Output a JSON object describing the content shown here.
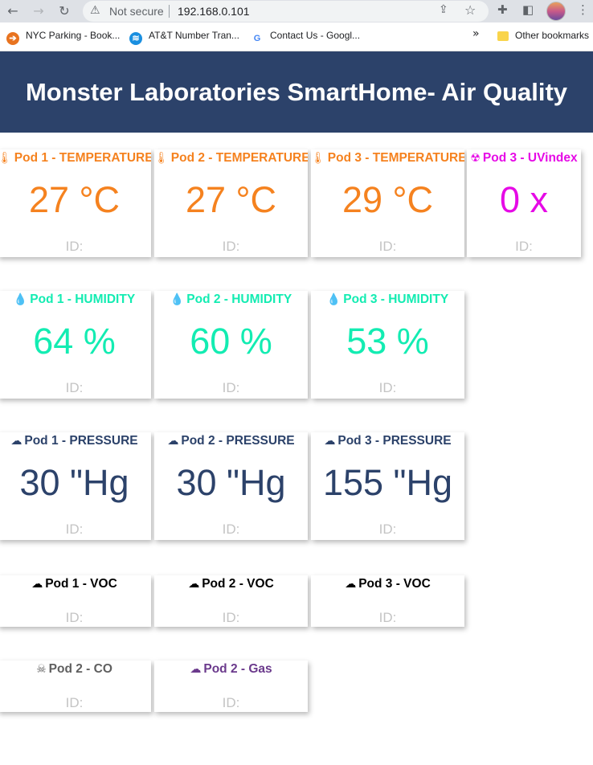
{
  "browser": {
    "back_icon": "←",
    "forward_icon": "→",
    "reload_icon": "↻",
    "security_icon": "⚠",
    "security_label": "Not secure",
    "url": "192.168.0.101",
    "share_icon": "⇪",
    "star_icon": "☆",
    "extensions_icon": "✚",
    "sidepanel_icon": "◧",
    "menu_icon": "⋮",
    "bookmarks": [
      {
        "icon": "➔",
        "label": "NYC Parking - Book..."
      },
      {
        "icon": "≋",
        "label": "AT&T Number Tran..."
      },
      {
        "icon": "G",
        "label": "Contact Us - Googl..."
      }
    ],
    "bookmarks_more_icon": "»",
    "other_bookmarks_label": "Other bookmarks"
  },
  "header": {
    "title": "Monster Laboratories SmartHome- Air Quality"
  },
  "colors": {
    "header_bg": "#2c426a",
    "temperature": "#f5821f",
    "uvindex": "#e60ae6",
    "humidity": "#13ecb2",
    "pressure": "#2c426a",
    "voc": "#000000",
    "co": "#5f5f5f",
    "gas": "#6b3a8c"
  },
  "temperature": [
    {
      "icon": "🌡",
      "title": "Pod 1 - TEMPERATURE",
      "value": "27 °C",
      "id_label": "ID:"
    },
    {
      "icon": "🌡",
      "title": "Pod 2 - TEMPERATURE",
      "value": "27 °C",
      "id_label": "ID:"
    },
    {
      "icon": "🌡",
      "title": "Pod 3 - TEMPERATURE",
      "value": "29 °C",
      "id_label": "ID:"
    }
  ],
  "uvindex": {
    "icon": "☢",
    "title": "Pod 3 - UVindex",
    "value": "0 x",
    "id_label": "ID:"
  },
  "humidity": [
    {
      "icon": "💧",
      "title": "Pod 1 - HUMIDITY",
      "value": "64 %",
      "id_label": "ID:"
    },
    {
      "icon": "💧",
      "title": "Pod 2 - HUMIDITY",
      "value": "60 %",
      "id_label": "ID:"
    },
    {
      "icon": "💧",
      "title": "Pod 3 - HUMIDITY",
      "value": "53 %",
      "id_label": "ID:"
    }
  ],
  "pressure": [
    {
      "icon": "☁",
      "title": "Pod 1 - PRESSURE",
      "value": "30 \"Hg",
      "id_label": "ID:"
    },
    {
      "icon": "☁",
      "title": "Pod 2 - PRESSURE",
      "value": "30 \"Hg",
      "id_label": "ID:"
    },
    {
      "icon": "☁",
      "title": "Pod 3 - PRESSURE",
      "value": "155 \"Hg",
      "id_label": "ID:"
    }
  ],
  "voc": [
    {
      "icon": "☁",
      "title": "Pod 1 - VOC",
      "id_label": "ID:"
    },
    {
      "icon": "☁",
      "title": "Pod 2 - VOC",
      "id_label": "ID:"
    },
    {
      "icon": "☁",
      "title": "Pod 3 - VOC",
      "id_label": "ID:"
    }
  ],
  "co": {
    "icon": "☠",
    "title": "Pod 2 - CO",
    "id_label": "ID:"
  },
  "gas": {
    "icon": "☁",
    "title": "Pod 2 - Gas",
    "id_label": "ID:"
  }
}
